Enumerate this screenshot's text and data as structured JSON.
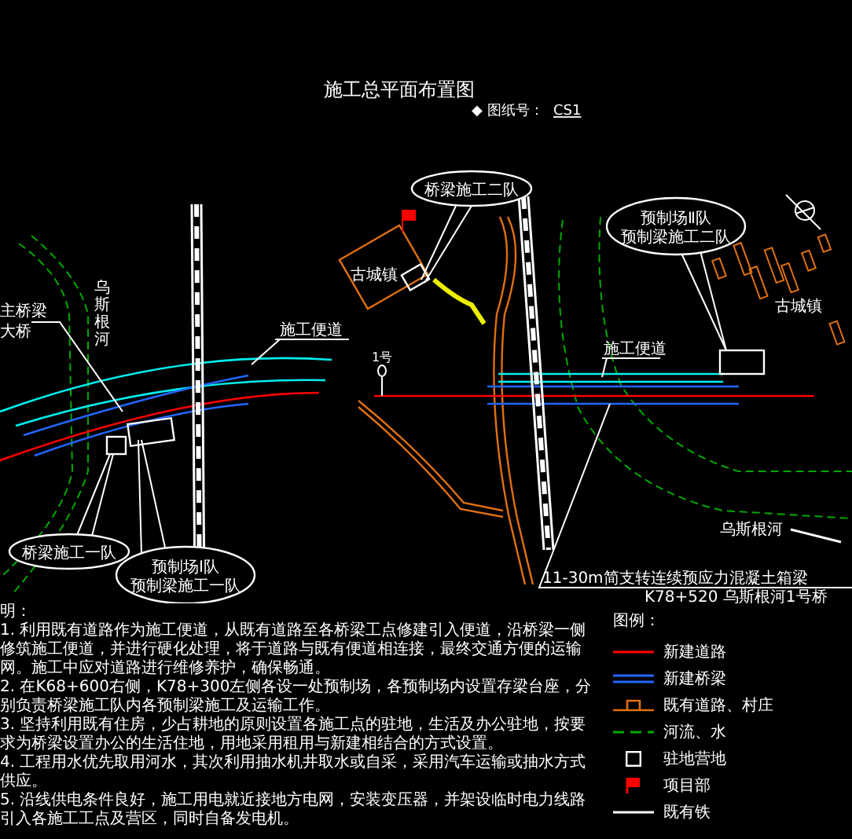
{
  "title": "施工总平面布置图",
  "drawing_number": {
    "label": "◆ 图纸号：",
    "value": "CS1"
  },
  "callouts": [
    {
      "lines": [
        "桥梁施工二队"
      ]
    },
    {
      "lines": [
        "预制场Ⅱ队",
        "预制梁施工二队"
      ]
    },
    {
      "lines": [
        "桥梁施工一队"
      ]
    },
    {
      "lines": [
        "预制场Ⅰ队",
        "预制梁施工一队"
      ]
    }
  ],
  "bridge_labels": [
    "主桥梁",
    "大桥"
  ],
  "town_labels": [
    "古城镇",
    "古城镇"
  ],
  "river_labels": [
    "乌斯根河",
    "乌斯根河"
  ],
  "road_labels": [
    "施工便道",
    "施工便道"
  ],
  "marker_label": "1号",
  "bridge_note": [
    "11-30m简支转连续预应力混凝土箱梁",
    "K78+520 乌斯根河1号桥"
  ],
  "notes": {
    "title": "明：",
    "items": [
      "1. 利用既有道路作为施工便道，从既有道路至各桥梁工点修建引入便道，沿桥梁一侧修筑施工便道，并进行硬化处理，将于道路与既有便道相连接，最终交通方便的运输网。施工中应对道路进行维修养护，确保畅通。",
      "2. 在K68+600右侧，K78+300左侧各设一处预制场，各预制场内设置存梁台座，分别负责桥梁施工队内各预制梁施工及运输工作。",
      "3. 坚持利用既有住房，少占耕地的原则设置各施工点的驻地，生活及办公驻地，按要求为桥梁设置办公的生活住地，用地采用租用与新建相结合的方式设置。",
      "4. 工程用水优先取用河水，其次利用抽水机井取水或自采，采用汽车运输或抽水方式供应。",
      "5. 沿线供电条件良好，施工用电就近接地方电网，安装变压器，并架设临时电力线路引入各施工工点及营区，同时自备发电机。"
    ]
  },
  "legend": {
    "title": "图例：",
    "items": [
      {
        "kind": "new-road",
        "label": "新建道路"
      },
      {
        "kind": "new-bridge",
        "label": "新建桥梁"
      },
      {
        "kind": "existing-road",
        "label": "既有道路、村庄"
      },
      {
        "kind": "river",
        "label": "河流、水"
      },
      {
        "kind": "camp",
        "label": "驻地营地"
      },
      {
        "kind": "project-office",
        "label": "项目部"
      },
      {
        "kind": "railway",
        "label": "既有铁"
      }
    ]
  }
}
